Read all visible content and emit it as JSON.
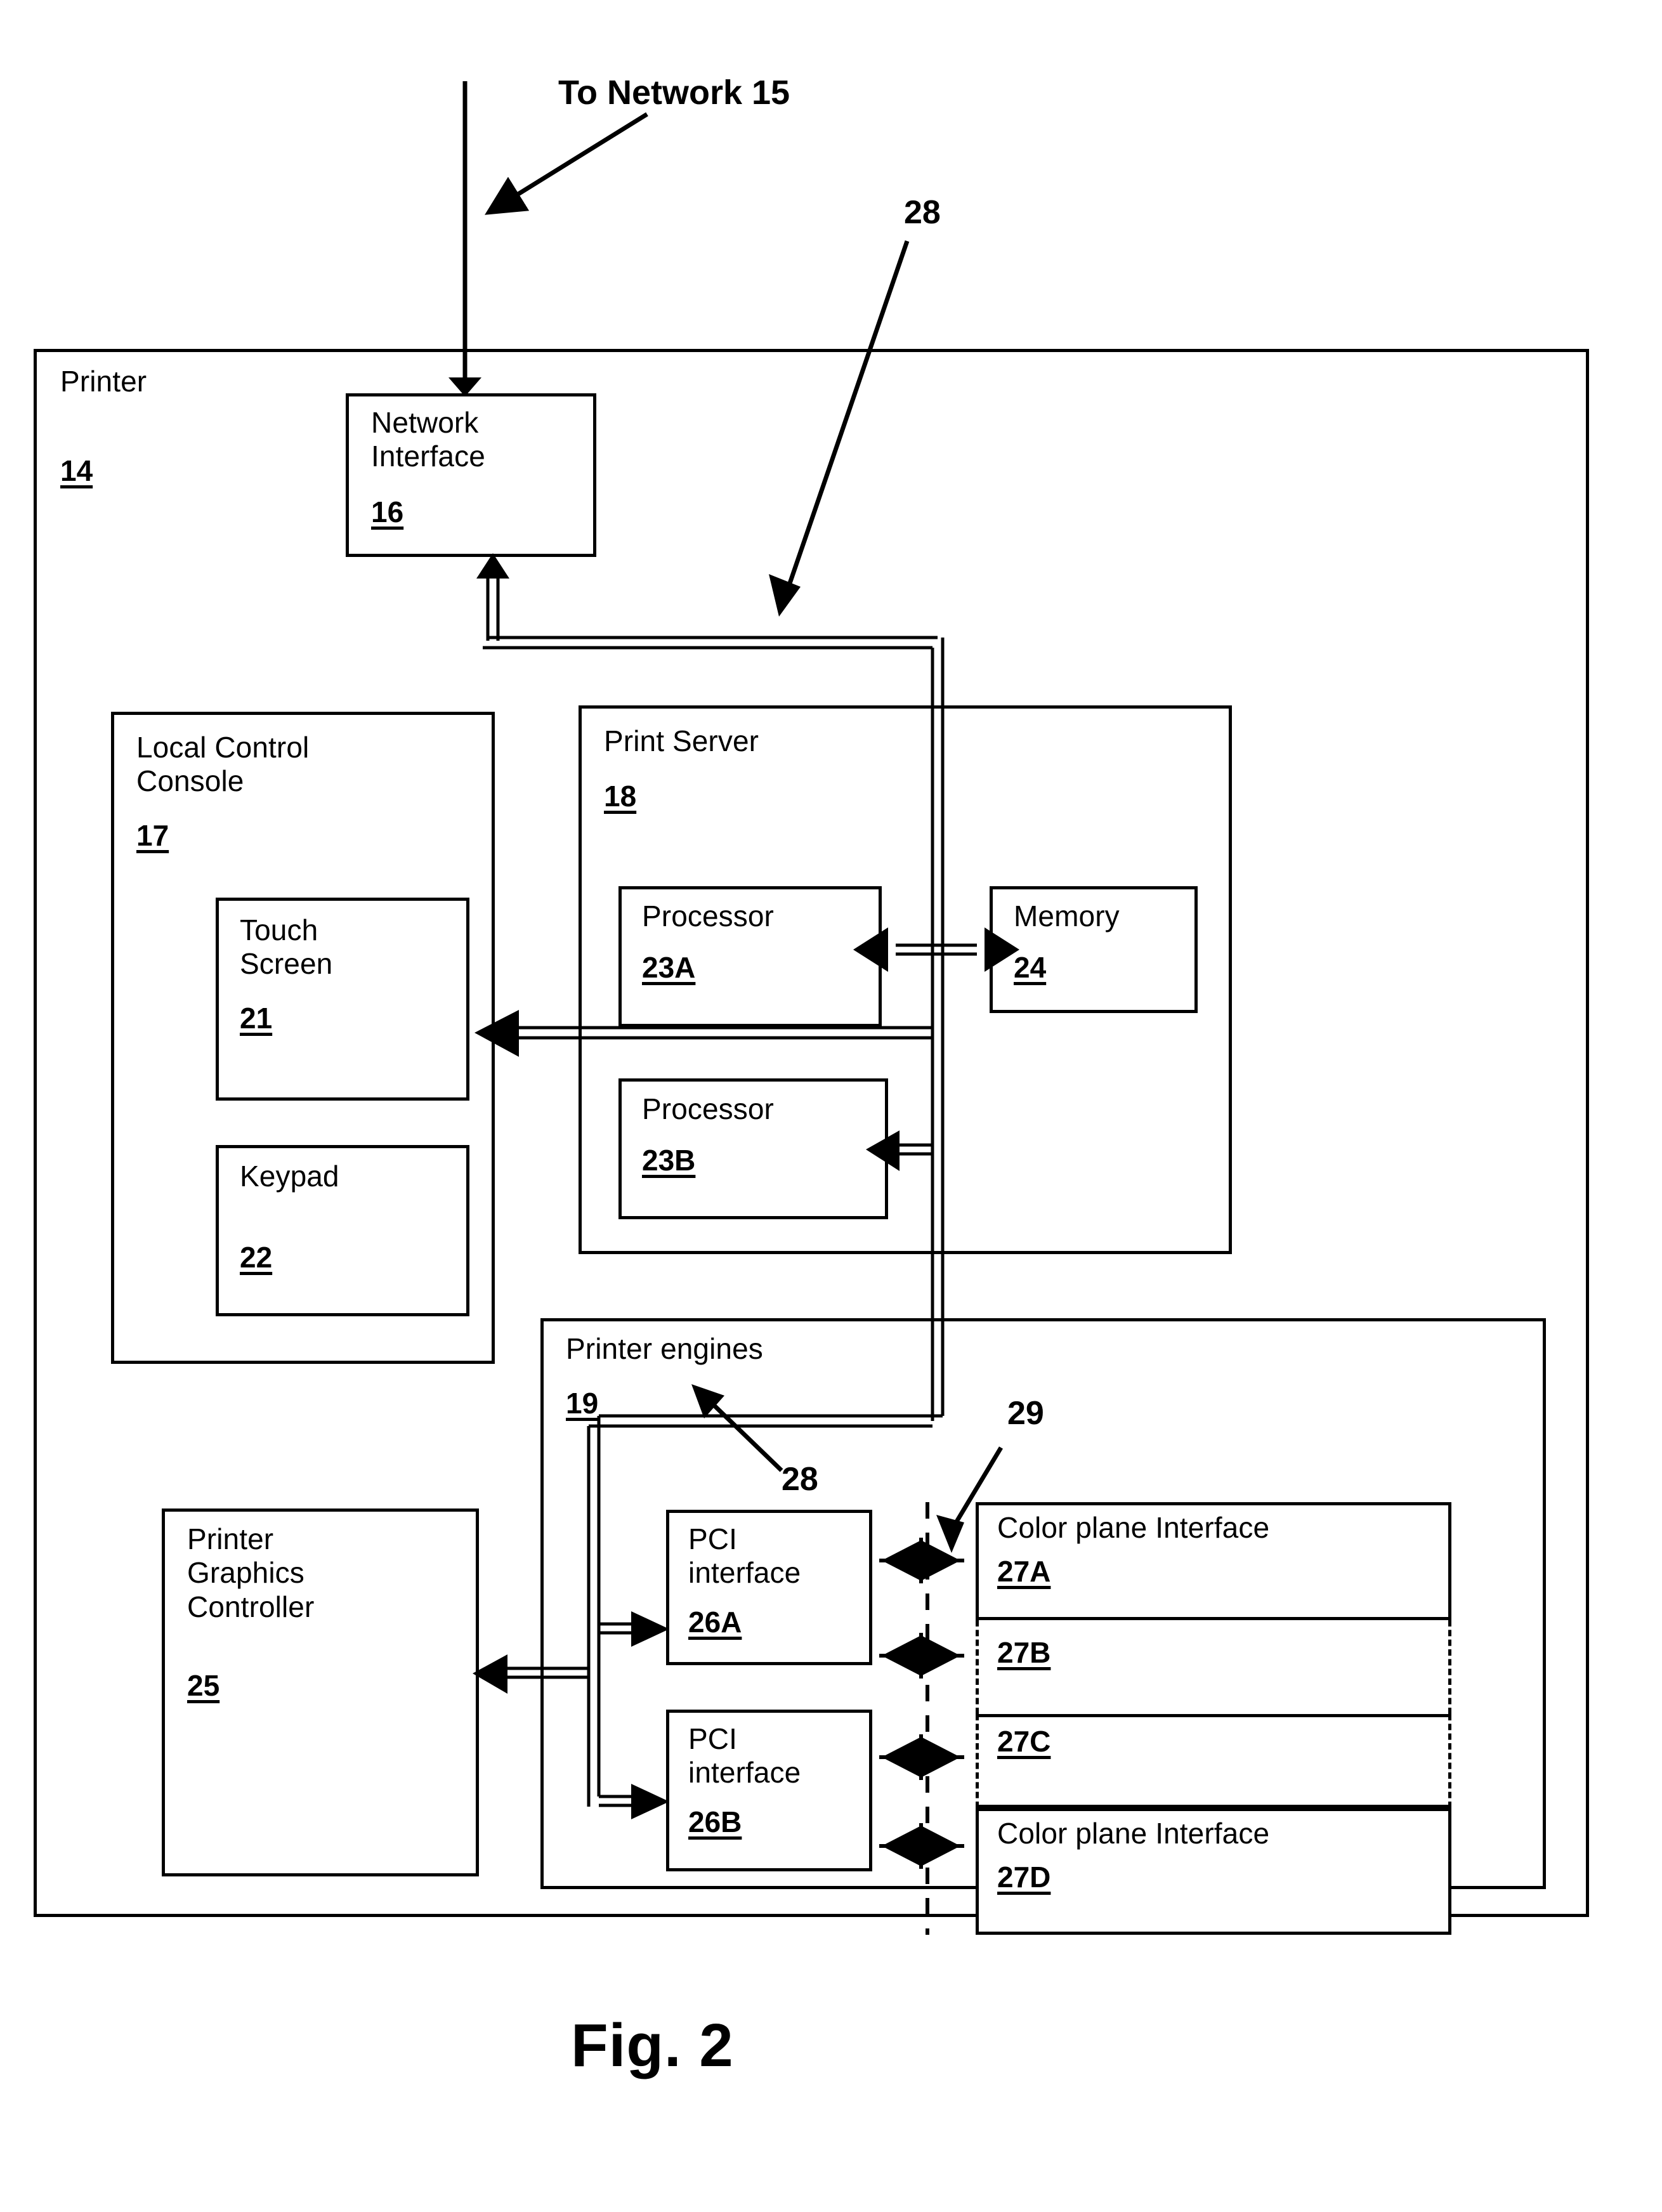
{
  "figure": {
    "caption": "Fig. 2",
    "network_label": "To Network 15"
  },
  "callouts": {
    "bus_top": "28",
    "bus_engines": "28",
    "color_plane_bus": "29"
  },
  "printer": {
    "title": "Printer",
    "ref": "14",
    "network_interface": {
      "title": "Network\nInterface",
      "ref": "16"
    },
    "local_control_console": {
      "title": "Local Control\nConsole",
      "ref": "17",
      "touch_screen": {
        "title": "Touch\nScreen",
        "ref": "21"
      },
      "keypad": {
        "title": "Keypad",
        "ref": "22"
      }
    },
    "print_server": {
      "title": "Print Server",
      "ref": "18",
      "processor_a": {
        "title": "Processor",
        "ref": "23A"
      },
      "processor_b": {
        "title": "Processor",
        "ref": "23B"
      },
      "memory": {
        "title": "Memory",
        "ref": "24"
      }
    },
    "printer_graphics_controller": {
      "title": "Printer\nGraphics\nController",
      "ref": "25"
    },
    "printer_engines": {
      "title": "Printer engines",
      "ref": "19",
      "pci_interfaces": [
        {
          "title": "PCI\ninterface",
          "ref": "26A"
        },
        {
          "title": "PCI\ninterface",
          "ref": "26B"
        }
      ],
      "color_plane_interfaces": [
        {
          "title": "Color plane Interface",
          "ref": "27A"
        },
        {
          "title": "",
          "ref": "27B"
        },
        {
          "title": "",
          "ref": "27C"
        },
        {
          "title": "Color plane Interface",
          "ref": "27D"
        }
      ]
    }
  },
  "colors": {
    "ink": "#000000",
    "paper": "#ffffff"
  }
}
